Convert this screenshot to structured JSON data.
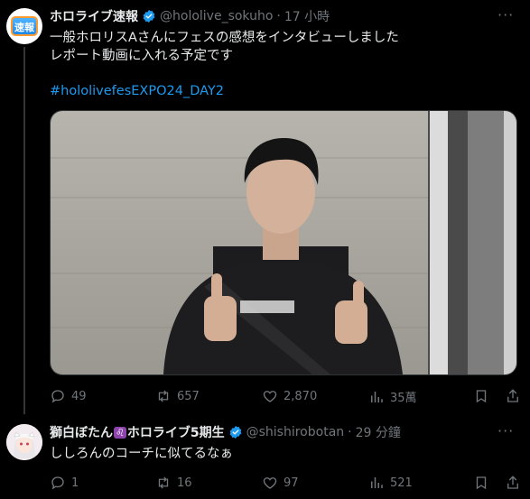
{
  "tweet1": {
    "avatar_text": "速報",
    "name": "ホロライブ速報",
    "handle": "@hololive_sokuho",
    "separator": "·",
    "time": "17 小時",
    "more": "···",
    "line1": "一般ホロリスAさんにフェスの感想をインタビューしました",
    "line2": "レポート動画に入れる予定です",
    "hashtag": "#hololivefesEXPO24_DAY2",
    "actions": {
      "reply_count": "49",
      "retweet_count": "657",
      "like_count": "2,870",
      "views_count": "35萬"
    }
  },
  "tweet2": {
    "name": "獅白ぼたん",
    "name_emoji": "♌",
    "name_suffix": "ホロライブ5期生",
    "handle": "@shishirobotan",
    "separator": "·",
    "time": "29 分鐘",
    "more": "···",
    "text": "ししろんのコーチに似てるなぁ",
    "actions": {
      "reply_count": "1",
      "retweet_count": "16",
      "like_count": "97",
      "views_count": "521"
    }
  },
  "colors": {
    "background": "#000000",
    "text": "#e7e9ea",
    "muted": "#71767b",
    "link": "#1d9bf0",
    "verified": "#1d9bf0"
  }
}
